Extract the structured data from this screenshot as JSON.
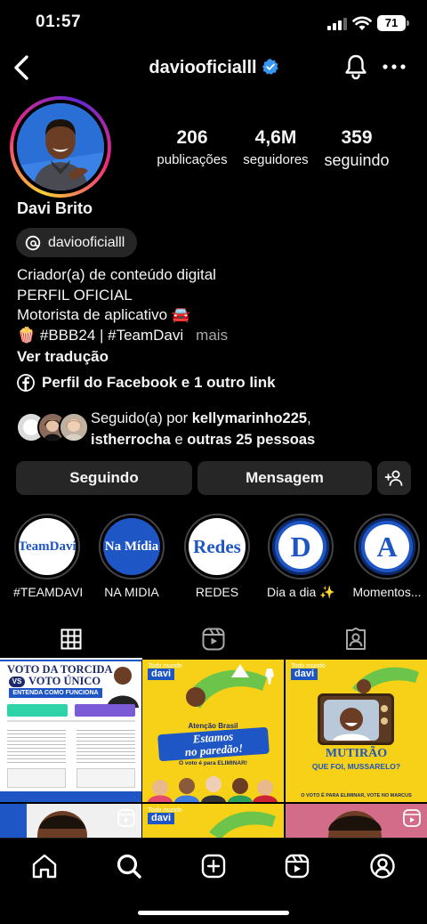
{
  "status_bar": {
    "time": "01:57",
    "battery": "71"
  },
  "header": {
    "username": "daviooficialll",
    "icons": [
      "back-icon",
      "verified-icon",
      "bell-icon",
      "more-icon"
    ]
  },
  "profile": {
    "full_name": "Davi Brito",
    "threads_handle": "daviooficialll",
    "stats": [
      {
        "value": "206",
        "label": "publicações"
      },
      {
        "value": "4,6M",
        "label": "seguidores"
      },
      {
        "value": "359",
        "label": "seguindo"
      }
    ],
    "bio": {
      "line1": "Criador(a) de conteúdo digital",
      "line2": "PERFIL OFICIAL",
      "line3": "Motorista de aplicativo 🚘",
      "line4": "🍿 #BBB24 | #TeamDavi",
      "more": "mais"
    },
    "translate": "Ver tradução",
    "link": "Perfil do Facebook e 1 outro link",
    "followed_by": {
      "prefix": "Seguido(a) por ",
      "user1": "kellymarinho225",
      "sep": ",",
      "user2": "istherrocha",
      "mid": " e ",
      "others": "outras 25 pessoas"
    }
  },
  "actions": {
    "follow_label": "Seguindo",
    "message_label": "Mensagem"
  },
  "highlights": [
    {
      "cover": "TeamDavi",
      "caption": "#TEAMDAVI"
    },
    {
      "cover": "Na Mídia",
      "caption": "NA MIDIA"
    },
    {
      "cover": "Redes",
      "caption": "REDES"
    },
    {
      "cover": "D",
      "caption": "Dia a dia ✨"
    },
    {
      "cover": "A",
      "caption": "Momentos..."
    }
  ],
  "grid_posts": {
    "post1": {
      "title_a": "VOTO DA TORCIDA",
      "title_vs": "VS",
      "title_b": "VOTO ÚNICO",
      "subtitle": "ENTENDA COMO FUNCIONA"
    },
    "post2": {
      "tag_a": "Todo mundo",
      "tag_b": "davi",
      "kicker": "Atenção Brasil",
      "headline_a": "Estamos",
      "headline_b": "no paredão!",
      "footer": "O voto é para ELIMINAR!"
    },
    "post3": {
      "tag_a": "Todo mundo",
      "tag_b": "davi",
      "headline_a": "MUTIRÃO",
      "headline_b": "QUE FOI, MUSSARELO?",
      "footer": "O VOTO É PARA ELIMINAR, VOTE NO MARCUS"
    },
    "post5": {
      "tag_a": "Todo mundo",
      "tag_b": "davi"
    }
  },
  "colors": {
    "background": "#000000",
    "button": "#262626",
    "verified": "#3897f0",
    "post_yellow": "#f7d117",
    "highlight_blue": "#1e56c6"
  }
}
